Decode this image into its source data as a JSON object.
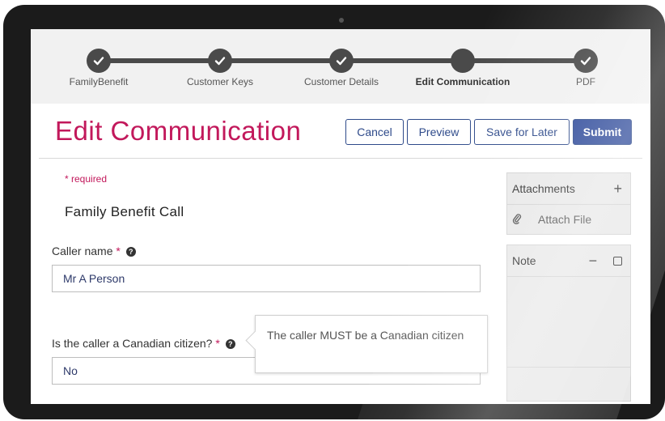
{
  "stepper": {
    "steps": [
      {
        "label": "FamilyBenefit",
        "state": "complete"
      },
      {
        "label": "Customer Keys",
        "state": "complete"
      },
      {
        "label": "Customer Details",
        "state": "complete"
      },
      {
        "label": "Edit Communication",
        "state": "current"
      },
      {
        "label": "PDF",
        "state": "complete"
      }
    ]
  },
  "header": {
    "title": "Edit Communication",
    "buttons": {
      "cancel": "Cancel",
      "preview": "Preview",
      "save_later": "Save for Later",
      "submit": "Submit"
    }
  },
  "form": {
    "required_note": "* required",
    "section_title": "Family Benefit Call",
    "caller_name": {
      "label": "Caller name",
      "required_mark": "*",
      "value": "Mr A Person"
    },
    "citizen": {
      "label": "Is the caller a Canadian citizen?",
      "required_mark": "*",
      "value": "No"
    },
    "tooltip": "The caller MUST be a Canadian citizen"
  },
  "sidebar": {
    "attachments": {
      "title": "Attachments",
      "add_symbol": "+",
      "attach_label": "Attach File"
    },
    "note": {
      "title": "Note",
      "minimize_symbol": "−"
    }
  },
  "colors": {
    "title": "#c2185b",
    "primary_button": "#2e4a9a",
    "stepper_node": "#4a4a4a"
  }
}
